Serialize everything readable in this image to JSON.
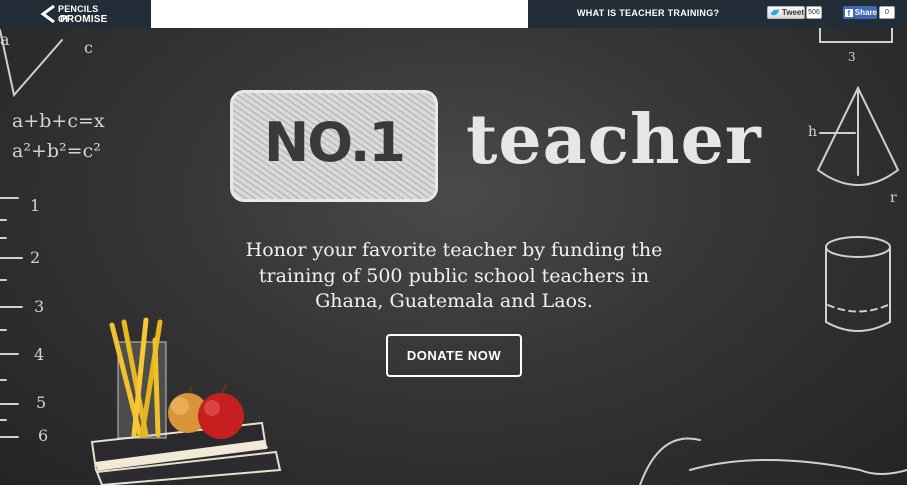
{
  "header": {
    "logo_line1": "PENCILS OF",
    "logo_line2": "PROMISE",
    "nav_link": "WHAT IS TEACHER TRAINING?",
    "tweet_label": "Tweet",
    "tweet_count": "506",
    "share_label": "Share",
    "share_count": "0"
  },
  "hero": {
    "badge_text": "NO.1",
    "headline": "teacher",
    "tagline": "Honor your favorite teacher by funding the training of 500 public school teachers in Ghana, Guatemala and Laos.",
    "donate_label": "DONATE NOW"
  },
  "chalk": {
    "formula1": "a+b+c=x",
    "formula2": "a²+b²=c²",
    "letter_a": "a",
    "letter_c": "c",
    "ruler": [
      "1",
      "2",
      "3",
      "4",
      "5",
      "6"
    ],
    "letter_h": "h",
    "letter_r": "r",
    "num_3": "3"
  },
  "colors": {
    "topbar": "#232d38",
    "board": "#353535",
    "facebook": "#4267b2"
  }
}
